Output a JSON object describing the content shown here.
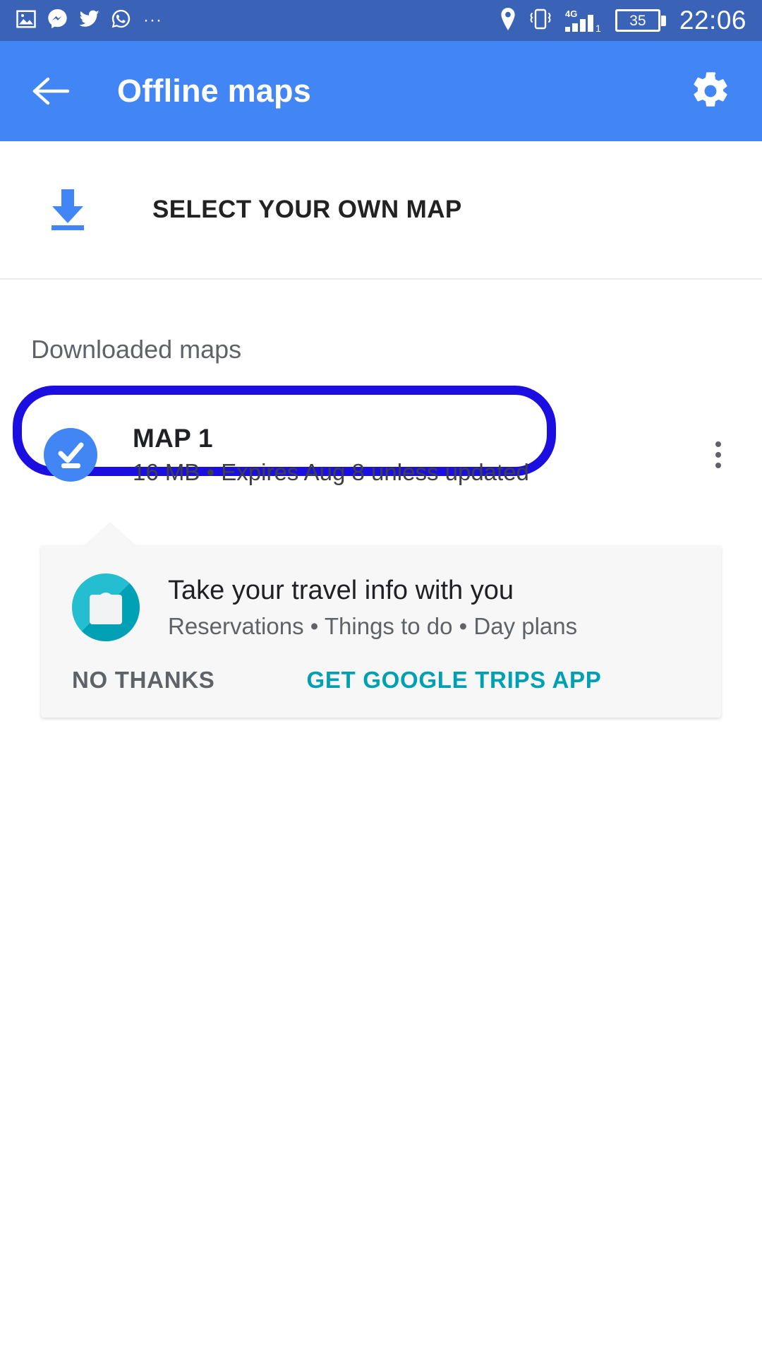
{
  "status_bar": {
    "background_color": "#3a63b8",
    "left_icons": [
      {
        "name": "screenshot-image-icon",
        "glyph": "image"
      },
      {
        "name": "facebook-messenger-icon",
        "glyph": "messenger"
      },
      {
        "name": "twitter-icon",
        "glyph": "twitter"
      },
      {
        "name": "whatsapp-icon",
        "glyph": "whatsapp"
      },
      {
        "name": "more-notifications-icon",
        "glyph": "…"
      }
    ],
    "more_dots": "···",
    "right_icons": [
      {
        "name": "location-pin-icon"
      },
      {
        "name": "vibrate-mode-icon"
      },
      {
        "name": "signal-4g-icon"
      }
    ],
    "network_type": "4G",
    "sim_slot": "1",
    "battery_level": "35",
    "clock": "22:06"
  },
  "app_bar": {
    "background_color": "#4285f4",
    "title": "Offline maps",
    "back_icon": "back-arrow-icon",
    "settings_icon": "gear-icon"
  },
  "select_own_map": {
    "label": "SELECT YOUR OWN MAP",
    "icon": "download-arrow-icon",
    "icon_color": "#4285f4"
  },
  "downloaded_section": {
    "title": "Downloaded maps",
    "highlight_color": "#1a0fe0",
    "maps": [
      {
        "name": "MAP 1",
        "details": "16 MB • Expires Aug 8 unless updated",
        "status_icon": "downloaded-check-icon",
        "overflow_icon": "more-vertical-icon"
      }
    ]
  },
  "promo_card": {
    "icon": "travel-bag-icon",
    "icon_color": "#00b3c8",
    "title": "Take your travel info with you",
    "subtitle": "Reservations • Things to do • Day plans",
    "dismiss_label": "NO THANKS",
    "accept_label": "GET GOOGLE TRIPS APP",
    "accent_color": "#00a0b4"
  }
}
